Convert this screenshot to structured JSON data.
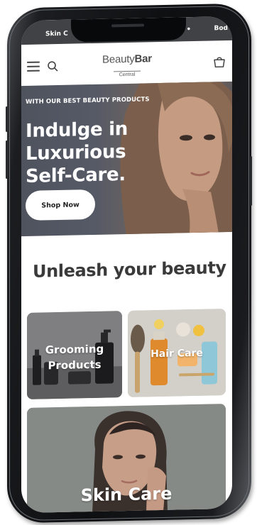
{
  "status_bar": {
    "left_text": "Skin C",
    "right_text": "Bod"
  },
  "header": {
    "logo_main_regular": "Beauty",
    "logo_main_bold": "Bar",
    "logo_sub": "Central"
  },
  "hero": {
    "kicker": "WITH OUR BEST BEAUTY PRODUCTS",
    "title_line1": "Indulge in Luxurious",
    "title_line2": "Self-Care.",
    "cta_label": "Shop Now"
  },
  "section": {
    "title": "Unleash your beauty"
  },
  "categories": [
    {
      "line1": "Grooming",
      "line2": "Products"
    },
    {
      "label": "Hair Care"
    },
    {
      "label": "Skin Care"
    }
  ],
  "icons": {
    "menu": "menu-icon",
    "search": "search-icon",
    "cart": "cart-icon"
  },
  "colors": {
    "hero_text": "#ffffff",
    "heading": "#3a3a3a",
    "button_bg": "#ffffff",
    "status_bar": "#404245"
  }
}
